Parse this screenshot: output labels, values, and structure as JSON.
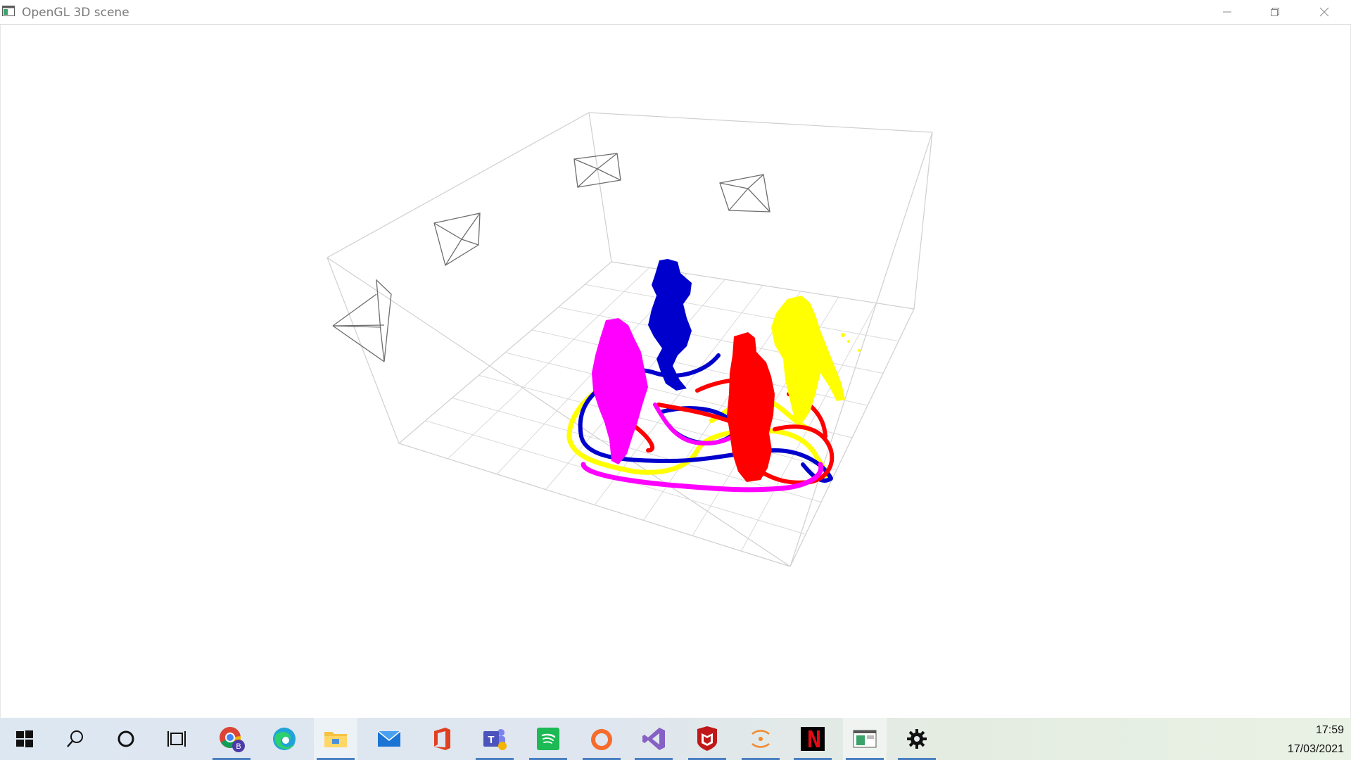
{
  "window": {
    "title": "OpenGL 3D scene",
    "controls": [
      "minimize",
      "restore",
      "close"
    ]
  },
  "scene": {
    "content": "3D point cloud view with wireframe room bounding box, floor grid, four camera frustums, four colored person point clouds and their trajectories",
    "cameras": 4,
    "persons": [
      {
        "color": "#0000ff"
      },
      {
        "color": "#ff00ff"
      },
      {
        "color": "#ff0000"
      },
      {
        "color": "#ffff00"
      }
    ],
    "colors": {
      "box": "#cfcfcf",
      "grid": "#d8d8d8",
      "camera": "#6e6e6e"
    }
  },
  "taskbar": {
    "apps": [
      {
        "name": "start-button",
        "icon": "windows-icon"
      },
      {
        "name": "search-button",
        "icon": "search-icon"
      },
      {
        "name": "cortana-button",
        "icon": "circle-icon"
      },
      {
        "name": "task-view-button",
        "icon": "task-view-icon"
      },
      {
        "name": "chrome-app",
        "icon": "chrome-icon"
      },
      {
        "name": "edge-app",
        "icon": "edge-icon"
      },
      {
        "name": "file-explorer-app",
        "icon": "folder-icon"
      },
      {
        "name": "mail-app",
        "icon": "mail-icon"
      },
      {
        "name": "office-app",
        "icon": "office-icon"
      },
      {
        "name": "teams-app",
        "icon": "teams-icon"
      },
      {
        "name": "spotify-app",
        "icon": "spotify-icon"
      },
      {
        "name": "origin-app",
        "icon": "origin-icon"
      },
      {
        "name": "visual-studio-app",
        "icon": "visual-studio-icon"
      },
      {
        "name": "mcafee-app",
        "icon": "mcafee-icon"
      },
      {
        "name": "eclipse-app",
        "icon": "eclipse-icon"
      },
      {
        "name": "netflix-app",
        "icon": "netflix-icon"
      },
      {
        "name": "opengl-window-app",
        "icon": "window-icon"
      },
      {
        "name": "settings-app",
        "icon": "gear-icon"
      }
    ],
    "clock": {
      "time": "17:59",
      "date": "17/03/2021"
    }
  }
}
